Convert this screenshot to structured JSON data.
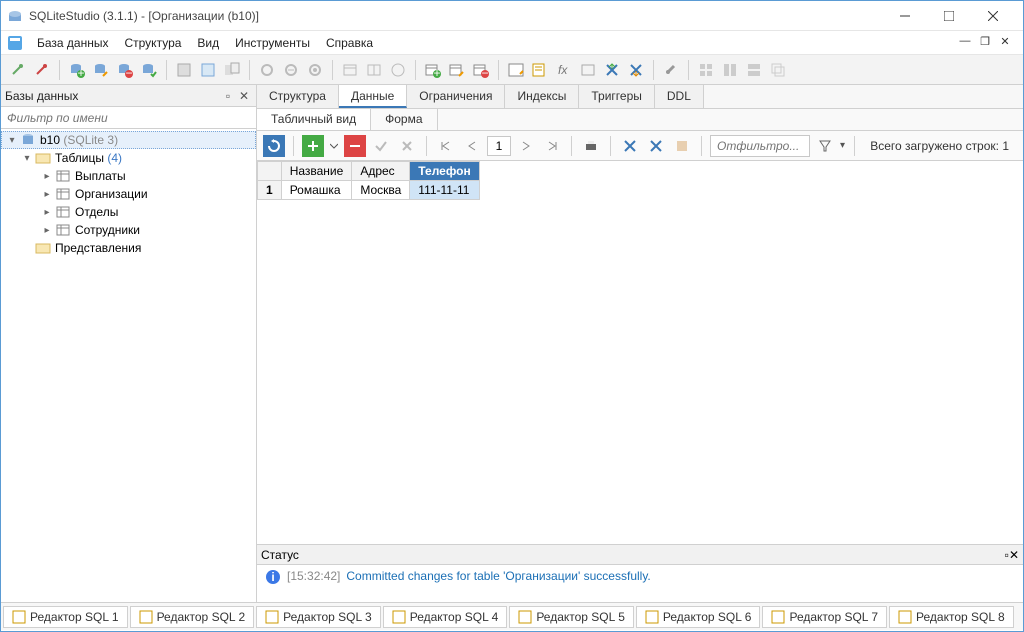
{
  "window": {
    "title": "SQLiteStudio (3.1.1) - [Организации (b10)]"
  },
  "menu": {
    "items": [
      "База данных",
      "Структура",
      "Вид",
      "Инструменты",
      "Справка"
    ]
  },
  "sidebar": {
    "title": "Базы данных",
    "filter_placeholder": "Фильтр по имени",
    "db_name": "b10",
    "db_engine": "(SQLite 3)",
    "tables_label": "Таблицы",
    "tables_count": "(4)",
    "tables": [
      "Выплаты",
      "Организации",
      "Отделы",
      "Сотрудники"
    ],
    "views_label": "Представления"
  },
  "main_tabs": [
    "Структура",
    "Данные",
    "Ограничения",
    "Индексы",
    "Триггеры",
    "DDL"
  ],
  "main_tab_active": 1,
  "sub_tabs": [
    "Табличный вид",
    "Форма"
  ],
  "sub_tab_active": 0,
  "data_toolbar": {
    "page": "1",
    "filter_placeholder": "Отфильтро...",
    "rows_loaded_label": "Всего загружено строк: 1"
  },
  "grid": {
    "columns": [
      "Название",
      "Адрес",
      "Телефон"
    ],
    "selected_column": 2,
    "rows": [
      {
        "n": "1",
        "cells": [
          "Ромашка",
          "Москва",
          "111-11-11"
        ]
      }
    ]
  },
  "status": {
    "title": "Статус",
    "time": "[15:32:42]",
    "message": "Committed changes for table 'Организации' successfully."
  },
  "bottom_tabs": [
    "Редактор SQL 1",
    "Редактор SQL 2",
    "Редактор SQL 3",
    "Редактор SQL 4",
    "Редактор SQL 5",
    "Редактор SQL 6",
    "Редактор SQL 7",
    "Редактор SQL 8"
  ]
}
